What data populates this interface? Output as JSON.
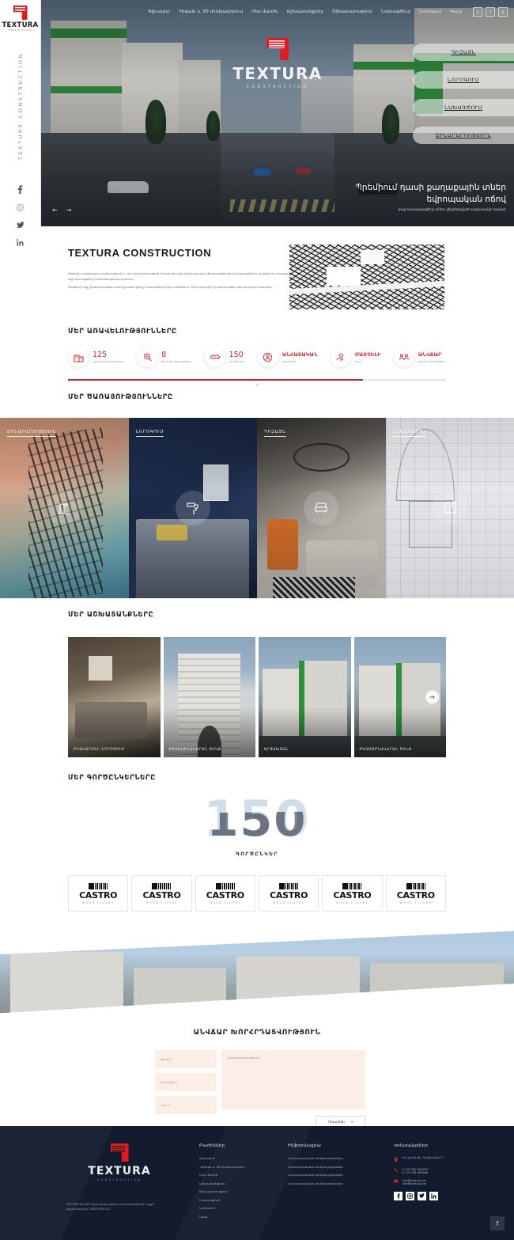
{
  "brand": {
    "name": "TEXTURA",
    "sub": "CONSTRUCTION",
    "vertical": "TEXTURE CONSTRUCTION"
  },
  "nav": {
    "items": [
      {
        "label": "Գլխավոր"
      },
      {
        "label": "Դիզայն և 3D մոդելավորում"
      },
      {
        "label": "Մեր մասին"
      },
      {
        "label": "Աշխատանքներ"
      },
      {
        "label": "Շինարարություն"
      },
      {
        "label": "Նախագծում"
      },
      {
        "label": "Նորոգում"
      },
      {
        "label": "Կապ"
      }
    ],
    "icons": [
      {
        "name": "user-icon",
        "glyph": "▯"
      },
      {
        "name": "search-icon",
        "glyph": "⌕"
      },
      {
        "name": "language-icon",
        "glyph": "◎"
      }
    ]
  },
  "hero": {
    "actions": [
      {
        "label": "ԴԻԶԱՅՆ"
      },
      {
        "label": "ՆՈՐՈԳՈՒՄ"
      },
      {
        "label": "ՆԱԽԱԳԾՈՒՄ"
      },
      {
        "label": "ՇԻՆԱՐԱՐՈՒԹՅՈՒՆ"
      }
    ],
    "caption_line1": "Պրեմիում դասի քաղաքային տներ",
    "caption_line2": "եվրոպական ոճով",
    "caption_sub": "բաց հատակագծով տներ վերբեռնված տախտակի համար",
    "prev": "←",
    "next": "→"
  },
  "about": {
    "title": "TEXTURA CONSTRUCTION",
    "paragraphs": [
      "Textura-ն առաջատար ընկերություն է, որը մասնագիտացած է համալիրային շինարարական ծառայությունների նախագծման, դիզայնի և որակյալ աշխատանքների իրականացման ոլորտում։",
      "Ծածկում ենք շինարարության ամբողջական ցիկլը՝ նախագծից մինչև հանձնում։ Մեզ հաջողվել է իրականացնել հարյուրավոր ծրագրեր։"
    ]
  },
  "advantages": {
    "title": "ՄԵՐ ԱՌԱՎԵԼՈՒԹՅՈՒՆՆԵՐԸ",
    "stats": [
      {
        "icon": "building-icon",
        "value": "125",
        "label": "ԿԱՌՈՒՑՎԱԾ ՆԱԽԱԳԾԵՐ",
        "type": "number"
      },
      {
        "icon": "medal-icon",
        "value": "8",
        "label": "ՏԱՐԻ ՓՈՐՁԱՌՈՒԹՅՈՒՆ",
        "type": "number"
      },
      {
        "icon": "handshake-icon",
        "value": "150",
        "label": "ԳՈՐԾԸՆԿԵՐ",
        "type": "number"
      },
      {
        "icon": "person-icon",
        "value": "ԱՆՀԱՏԱԿԱՆ",
        "label": "ՄՈՏԵՑՈՒՄ",
        "type": "word"
      },
      {
        "icon": "hand-coin-icon",
        "value": "ՄԱՏՉԵԼԻ",
        "label": "ԳՆԵՐ",
        "type": "word"
      },
      {
        "icon": "team-icon",
        "value": "ԱՆՎՃԱՐ",
        "label": "ԽՈՐՀՐԴԱՏՎՈՒԹՅՈՒՆ",
        "type": "word"
      }
    ],
    "progress_percent": 78,
    "handle": "⌭"
  },
  "services": {
    "title": "ՄԵՐ ԾԱՌԱՅՈՒԹՅՈՒՆՆԵՐԸ",
    "cards": [
      {
        "label": "ՇԻՆԱՐԱՐՈՒԹՅՈՒՆ",
        "icon": "crane-icon"
      },
      {
        "label": "ՆՈՐՈԳՈՒՄ",
        "icon": "paint-roller-icon"
      },
      {
        "label": "ԴԻԶԱՅՆ",
        "icon": "armchair-icon"
      },
      {
        "label": "ՆԱԽԱԳԾՈՒՄ",
        "icon": "blueprint-icon"
      }
    ]
  },
  "works": {
    "title": "ՄԵՐ ԱՇԽԱՏԱՆՔՆԵՐԸ",
    "items": [
      {
        "caption": "ԲՆԱԿԱՐԱՆԻ ՆՈՐՈԳՈՒՄ"
      },
      {
        "caption": "ԲԱԶՄԱԲՆԱԿԱՐԱՆ ՇԵՆՔ"
      },
      {
        "caption": "ԱՐՑԱԽՅԱՆ"
      },
      {
        "caption": "ԲԱԶՄԱԲՆԱԿԱՐԱՆ ՇԵՆՔ"
      }
    ],
    "next": "→"
  },
  "partners": {
    "title": "ՄԵՐ ԳՈՐԾԸՆԿԵՐՆԵՐԸ",
    "count": "150",
    "count_label": "ԳՈՐԾԸՆԿԵՐ",
    "logos": [
      {
        "name": "CASTRO",
        "sub": "WOOD FLOORS"
      },
      {
        "name": "CASTRO",
        "sub": "WOOD FLOORS"
      },
      {
        "name": "CASTRO",
        "sub": "WOOD FLOORS"
      },
      {
        "name": "CASTRO",
        "sub": "WOOD FLOORS"
      },
      {
        "name": "CASTRO",
        "sub": "WOOD FLOORS"
      },
      {
        "name": "CASTRO",
        "sub": "WOOD FLOORS"
      }
    ]
  },
  "contact": {
    "title": "ԱՆՎՃԱՐ ԽՈՐՀՐԴԱՏՎՈՒԹՅՈՒՆ",
    "fields": {
      "name": "Անուն *",
      "email": "Էլ.հասցե *",
      "phone": "Հեռ. *",
      "message": "Հաղորդագրություն *"
    },
    "submit": "Ուղարկել",
    "submit_arrow": "→"
  },
  "footer": {
    "copyright": "2021 ԹԱՐԳԵՆՏՈՒ Բոլոր իրավունքները պաշտպանված են։ Կայքի պատրաստումը՝ SAIDSTUDIO LLC",
    "columns": {
      "sections": {
        "title": "Բաժիններ",
        "items": [
          "Գլխավոր",
          "Դիզայն և 3D մոդելավորում",
          "Մեր մասին",
          "Աշխատանքներ",
          "Շինարարություն",
          "Նախագծում",
          "Նորոգում",
          "Կապ"
        ]
      },
      "info": {
        "title": "Ինֆորմացիա",
        "items": [
          "Նորարարական տեխնոլոգիաներ",
          "Նորարարական տեխնոլոգիաներ",
          "Նորարարական տեխնոլոգիաներ",
          "Նորարարական տեխնոլոգիաներ"
        ]
      },
      "contacts": {
        "title": "Կոնտակտներ",
        "address": "ՀՀ, ք.Երևան, Կոմիտասի 17",
        "phone1": "(+374 98) 909907",
        "phone2": "(+374 98) 909906",
        "email1": "info@textura.am",
        "email2": "info@textura.am"
      }
    },
    "socials": [
      {
        "name": "facebook-icon",
        "glyph": "f"
      },
      {
        "name": "instagram-icon",
        "glyph": "□"
      },
      {
        "name": "twitter-icon",
        "glyph": "ᴠ"
      },
      {
        "name": "linkedin-icon",
        "glyph": "in"
      }
    ],
    "to_top": "↑"
  },
  "colors": {
    "accent": "#d9232d",
    "footer_bg": "#121c2e",
    "field_bg": "#fbeee6"
  }
}
